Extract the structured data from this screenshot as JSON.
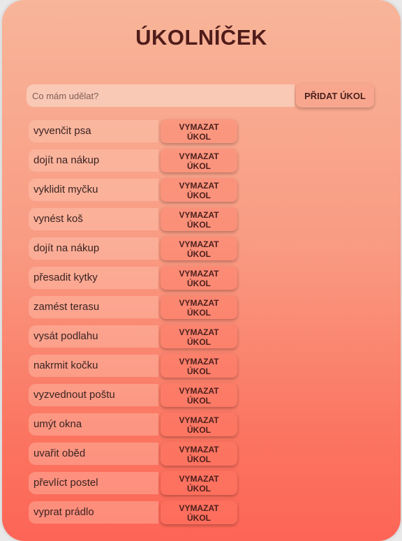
{
  "app": {
    "title": "ÚKOLNÍČEK"
  },
  "add": {
    "placeholder": "Co mám udělat?",
    "value": "",
    "button_label": "PŘIDAT ÚKOL"
  },
  "delete_label": {
    "line1": "VYMAZAT",
    "line2": "ÚKOL"
  },
  "tasks": [
    "vyvenčit psa",
    "dojít na nákup",
    "vyklidit myčku",
    "vynést koš",
    "dojít na nákup",
    "přesadit kytky",
    "zamést terasu",
    "vysát podlahu",
    "nakrmit kočku",
    "vyzvednout poštu",
    "umýt okna",
    "uvařit oběd",
    "převlíct postel",
    "vyprat prádlo"
  ],
  "colors": {
    "title": "#4f1c1a",
    "gradient_top": "#f8b599",
    "gradient_bottom": "#fd6556",
    "input_bg": "#f9c9b6"
  }
}
